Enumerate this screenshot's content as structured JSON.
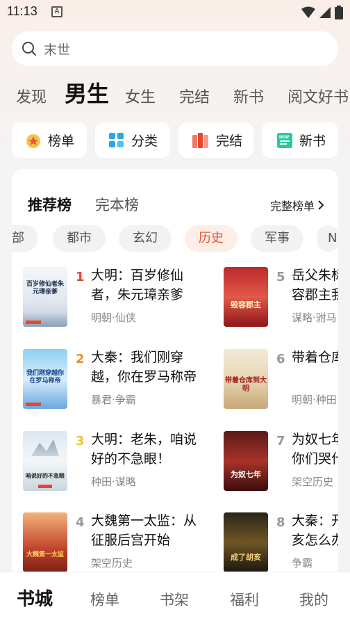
{
  "status": {
    "time": "11:13",
    "notif_letter": "A"
  },
  "search": {
    "placeholder": "末世"
  },
  "top_tabs": [
    "发现",
    "男生",
    "女生",
    "完结",
    "新书",
    "阅文好书"
  ],
  "active_top_tab": "男生",
  "quick_buttons": [
    {
      "label": "榜单",
      "icon": "rank-medal-icon"
    },
    {
      "label": "分类",
      "icon": "category-grid-icon"
    },
    {
      "label": "完结",
      "icon": "completed-books-icon"
    },
    {
      "label": "新书",
      "icon": "new-book-icon"
    }
  ],
  "card": {
    "title": "推荐榜",
    "title_alt": "完本榜",
    "full_list": "完整榜单"
  },
  "genres": [
    "部",
    "都市",
    "玄幻",
    "历史",
    "军事",
    "N"
  ],
  "active_genre": "历史",
  "books": [
    {
      "rank": "1",
      "title_line1": "大明：百岁修仙",
      "title_line2": "者，朱元璋亲爹",
      "tags": "明朝·仙侠",
      "cover_text": "百岁修仙者朱元璋亲爹"
    },
    {
      "rank": "2",
      "title_line1": "大秦：我们刚穿",
      "title_line2": "越，你在罗马称帝",
      "tags": "暴君·争霸",
      "cover_text": "我们刚穿越你在罗马称帝"
    },
    {
      "rank": "3",
      "title_line1": "大明：老朱，咱说",
      "title_line2": "好的不急眼！",
      "tags": "种田·谋略",
      "cover_text": "咱说好的不急眼"
    },
    {
      "rank": "4",
      "title_line1": "大魏第一太监：从",
      "title_line2": "征服后宫开始",
      "tags": "架空历史",
      "cover_text": "大魏第一太监"
    },
    {
      "rank": "5",
      "title_line1": "岳父朱标",
      "title_line2": "容郡主我",
      "tags": "谋略·驸马",
      "cover_text": "毁容郡主"
    },
    {
      "rank": "6",
      "title_line1": "带着仓库",
      "title_line2": "",
      "tags": "明朝·种田",
      "cover_text": "带着仓库到大明"
    },
    {
      "rank": "7",
      "title_line1": "为奴七年",
      "title_line2": "你们哭什么",
      "tags": "架空历史",
      "cover_text": "为奴七年"
    },
    {
      "rank": "8",
      "title_line1": "大秦：开",
      "title_line2": "亥怎么办",
      "tags": "争霸",
      "cover_text": "成了胡亥"
    }
  ],
  "rank_colors": {
    "1": "#e8443a",
    "2": "#f08a2c",
    "3": "#f2c12e",
    "other": "#999999"
  },
  "bottom_nav": [
    "书城",
    "榜单",
    "书架",
    "福利",
    "我的"
  ],
  "active_nav": "书城"
}
